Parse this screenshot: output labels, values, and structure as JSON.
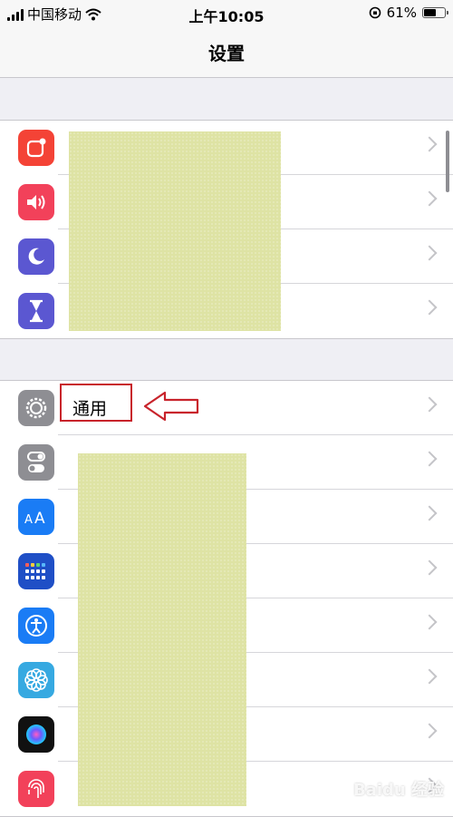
{
  "status_bar": {
    "carrier": "中国移动",
    "time": "上午10:05",
    "battery_percent": "61%",
    "battery_level": 0.61
  },
  "nav": {
    "title": "设置"
  },
  "groups": [
    {
      "rows": [
        {
          "icon": "notification-icon",
          "color": "#f44336",
          "label": ""
        },
        {
          "icon": "sound-icon",
          "color": "#f2415a",
          "label": ""
        },
        {
          "icon": "moon-icon",
          "color": "#5b57d1",
          "label": ""
        },
        {
          "icon": "hourglass-icon",
          "color": "#5b57d1",
          "label": ""
        }
      ]
    },
    {
      "rows": [
        {
          "icon": "gear-icon",
          "color": "#8e8e93",
          "label": "通用"
        },
        {
          "icon": "toggle-icon",
          "color": "#8e8e93",
          "label": ""
        },
        {
          "icon": "text-size-icon",
          "color": "#1a7cf5",
          "label": ""
        },
        {
          "icon": "grid-icon",
          "color": "#1f4fc6",
          "label": ""
        },
        {
          "icon": "accessibility-icon",
          "color": "#1a7cf5",
          "label": ""
        },
        {
          "icon": "flower-icon",
          "color": "#36a9e1",
          "label": ""
        },
        {
          "icon": "siri-icon",
          "color": "#111111",
          "label": ""
        },
        {
          "icon": "fingerprint-icon",
          "color": "#f2415a",
          "label": ""
        }
      ]
    }
  ],
  "colors": {
    "highlight": "#c8232b",
    "redaction": "#dee3a4"
  },
  "watermark": "Baidu 经验"
}
